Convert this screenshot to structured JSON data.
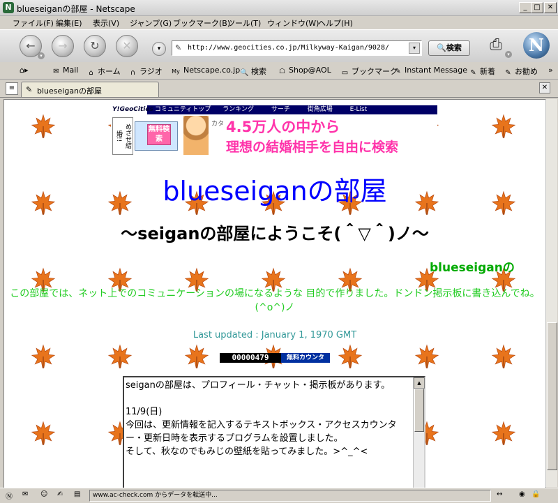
{
  "window": {
    "title": "blueseiganの部屋 - Netscape"
  },
  "menu": [
    "ファイル(F)",
    "編集(E)",
    "表示(V)",
    "ジャンプ(G)",
    "ブックマーク(B)",
    "ツール(T)",
    "ウィンドウ(W)",
    "ヘルプ(H)"
  ],
  "nav": {
    "url": "http://www.geocities.co.jp/Milkyway-Kaigan/9028/",
    "search_label": "検索"
  },
  "personal_toolbar": [
    "Mail",
    "ホーム",
    "ラジオ",
    "Netscape.co.jp",
    "検索",
    "Shop@AOL",
    "ブックマーク",
    "Instant Message",
    "新着",
    "お勧め"
  ],
  "tab": {
    "label": "blueseiganの部屋"
  },
  "page": {
    "geocities_nav": [
      "コミュニティトップ",
      "ランキング",
      "サーチ",
      "街角広場",
      "E-List"
    ],
    "banner": {
      "side_text": "めざせ結婚!!",
      "button": "無料検索",
      "katakana": "カタ",
      "line1": "4.5万人の中から",
      "line2": "理想の結婚相手を自由に検索"
    },
    "title": "blueseiganの部屋",
    "welcome": "～seiganの部屋にようこそ(＾▽＾)ノ～",
    "signature": "blueseiganの",
    "intro": "この部屋では、ネット上でのコミュニケーションの場になるような 目的で作りました。ドンドン掲示板に書き込んでね。(^o^)ノ",
    "updated": "Last updated : January 1, 1970 GMT",
    "counter": {
      "value": "00000479",
      "label": "無料カウンタ"
    },
    "news": "seiganの部屋は、プロフィール・チャット・掲示板があります。\n\n11/9(日)\n今回は、更新情報を記入するテキストボックス・アクセスカウンター・更新日時を表示するプログラムを設置しました。\nそして、秋なのでもみじの壁紙を貼ってみました。>^_^<"
  },
  "status": {
    "message": "www.ac-check.com からデータを転送中..."
  },
  "colors": {
    "title_blue": "#0000ff",
    "intro_green": "#22cc22",
    "signature_green": "#00aa00",
    "updated_teal": "#339999",
    "leaf_orange": "#e8741c"
  }
}
